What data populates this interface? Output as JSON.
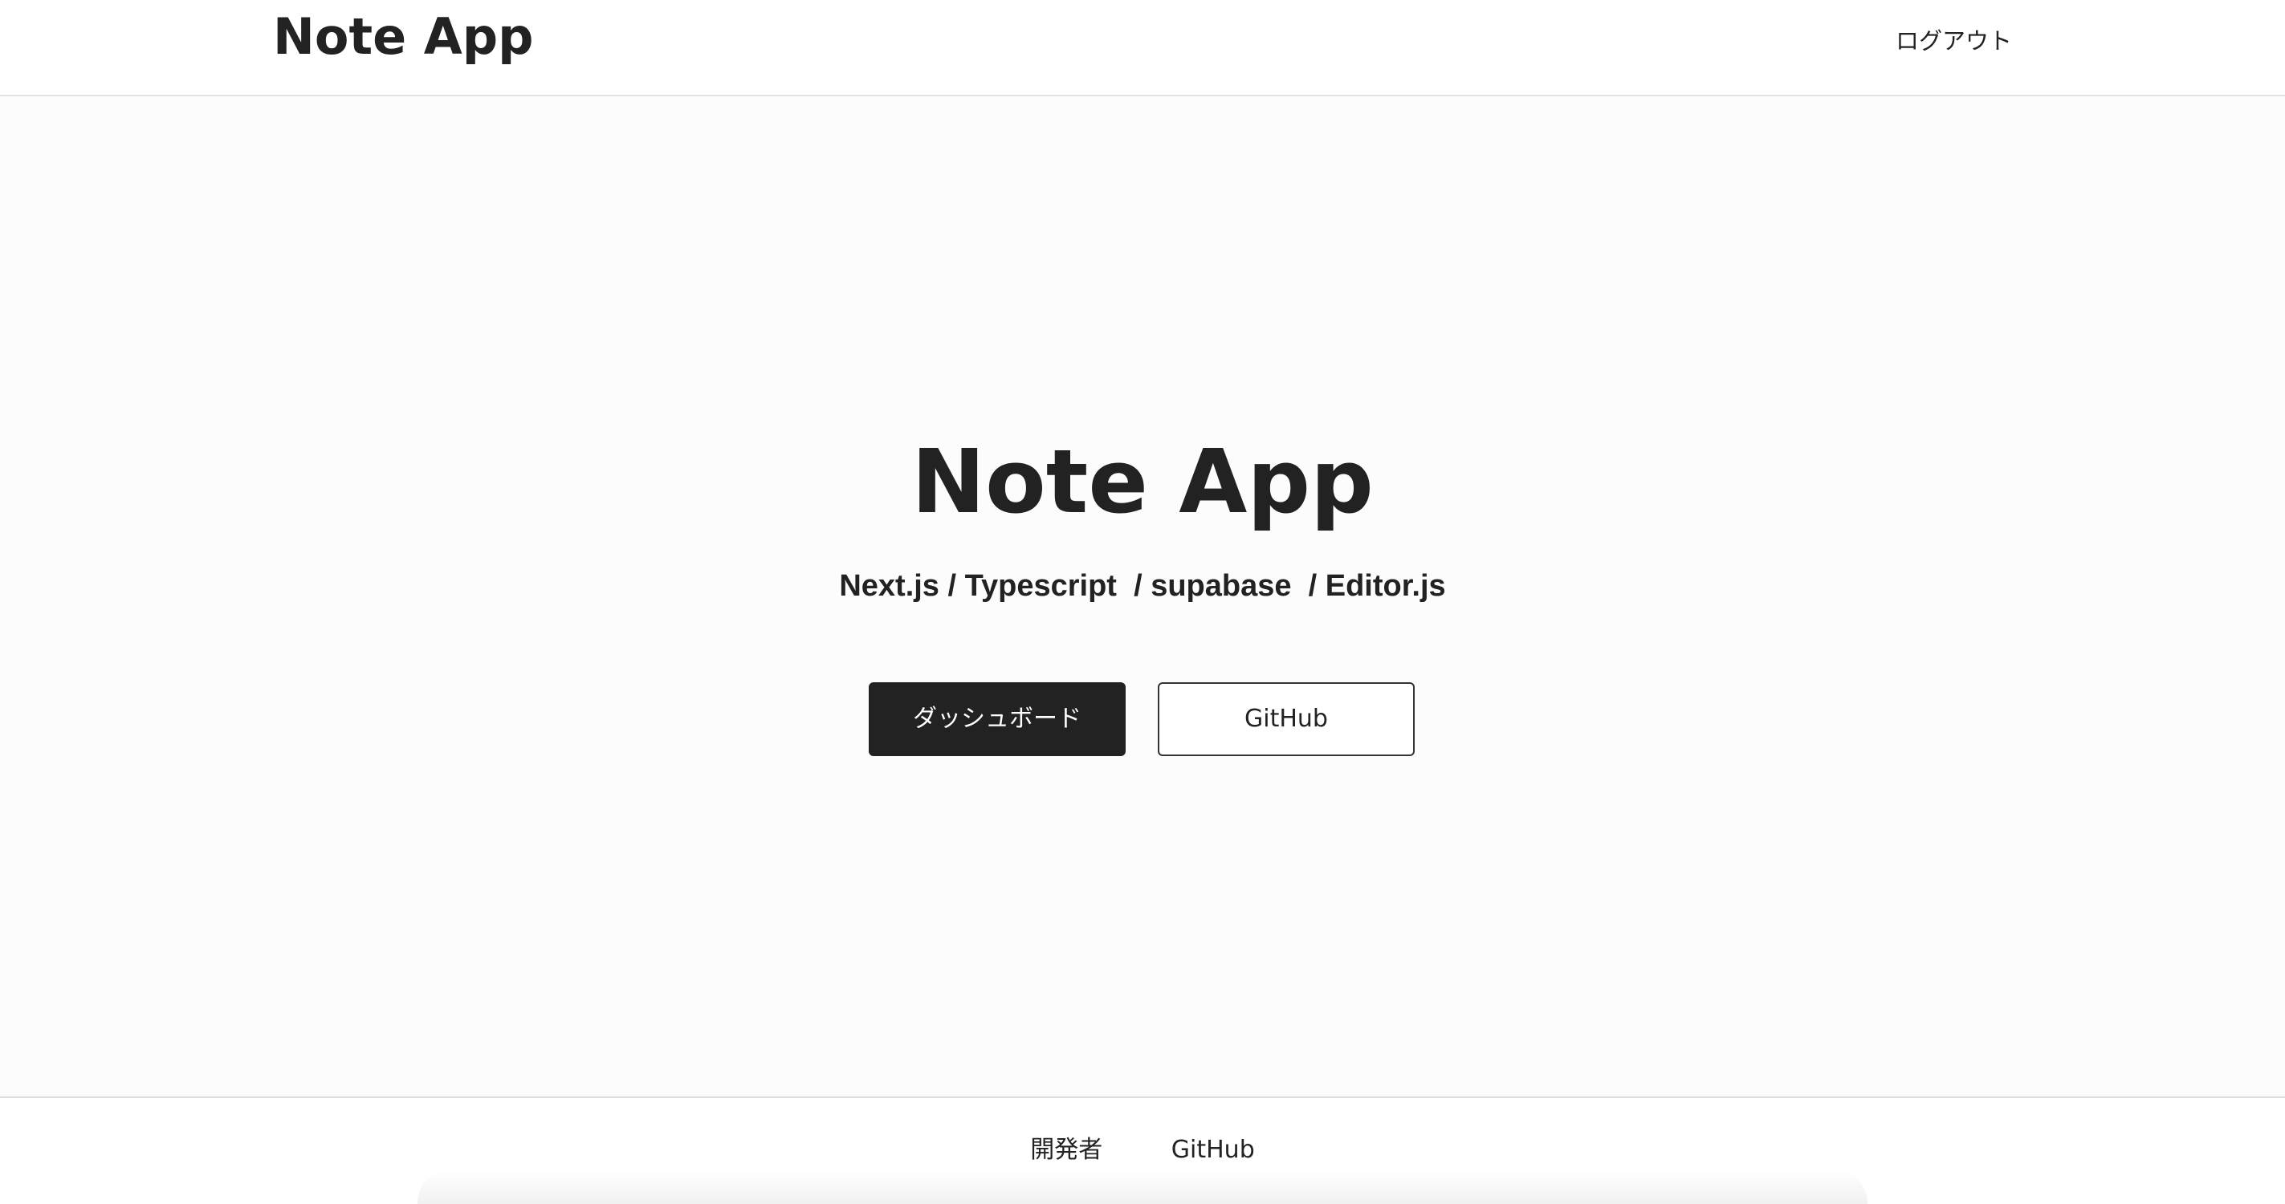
{
  "header": {
    "logo": "Note App",
    "logout_label": "ログアウト"
  },
  "hero": {
    "title": "Note App",
    "subtitle": "Next.js / Typescript  / supabase  / Editor.js",
    "primary_button_label": "ダッシュボード",
    "secondary_button_label": "GitHub"
  },
  "footer": {
    "links": [
      {
        "label": "開発者"
      },
      {
        "label": "GitHub"
      }
    ]
  },
  "colors": {
    "text": "#222222",
    "primary_button_bg": "#222222",
    "primary_button_text": "#ffffff",
    "background": "#ffffff",
    "hero_background": "#fdfcfd",
    "divider": "#e2e2e2"
  }
}
